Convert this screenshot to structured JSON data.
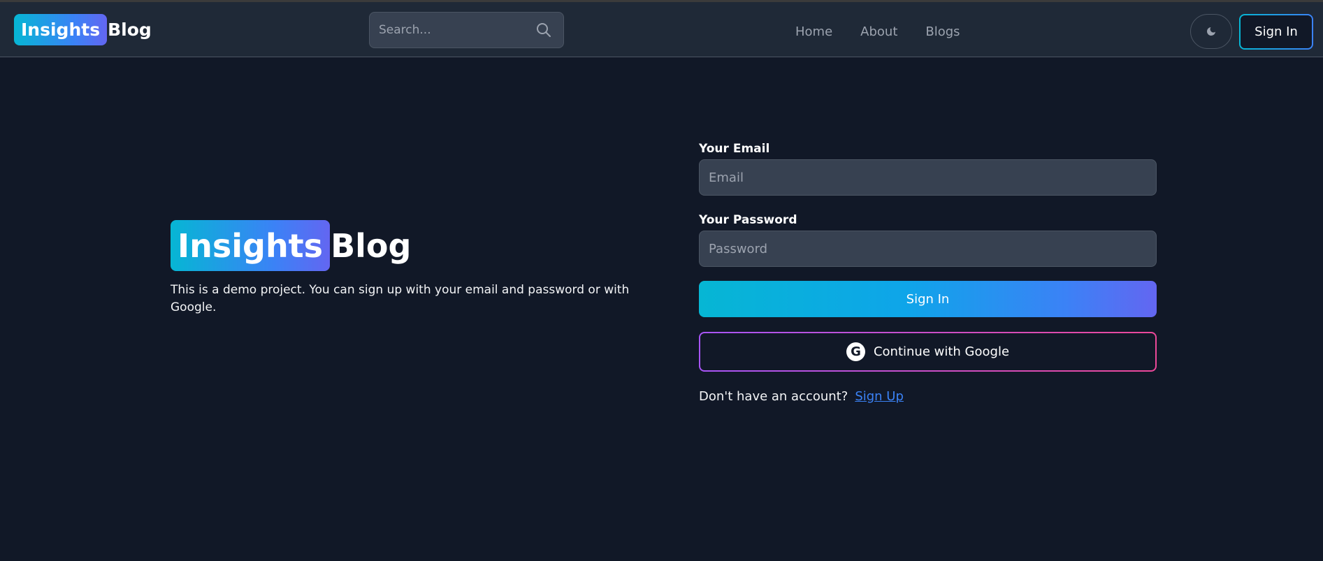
{
  "header": {
    "logo": {
      "highlight": "Insights",
      "rest": "Blog"
    },
    "search": {
      "placeholder": "Search..."
    },
    "nav": [
      {
        "label": "Home"
      },
      {
        "label": "About"
      },
      {
        "label": "Blogs"
      }
    ],
    "theme_icon": "moon-icon",
    "signin_label": "Sign In"
  },
  "hero": {
    "logo": {
      "highlight": "Insights",
      "rest": "Blog"
    },
    "description": "This is a demo project. You can sign up with your email and password or with Google."
  },
  "form": {
    "email": {
      "label": "Your Email",
      "placeholder": "Email"
    },
    "password": {
      "label": "Your Password",
      "placeholder": "Password"
    },
    "submit_label": "Sign In",
    "google": {
      "icon": "google-icon",
      "glyph": "G",
      "label": "Continue with Google"
    },
    "signup": {
      "question": "Don't have an account?",
      "link": "Sign Up"
    }
  },
  "colors": {
    "background": "#111827",
    "header": "#1f2937",
    "input": "#374151",
    "accent_start": "#06b6d4",
    "accent_end": "#6366f1",
    "google_border_start": "#a855f7",
    "google_border_end": "#ec4899",
    "link": "#3b82f6"
  }
}
